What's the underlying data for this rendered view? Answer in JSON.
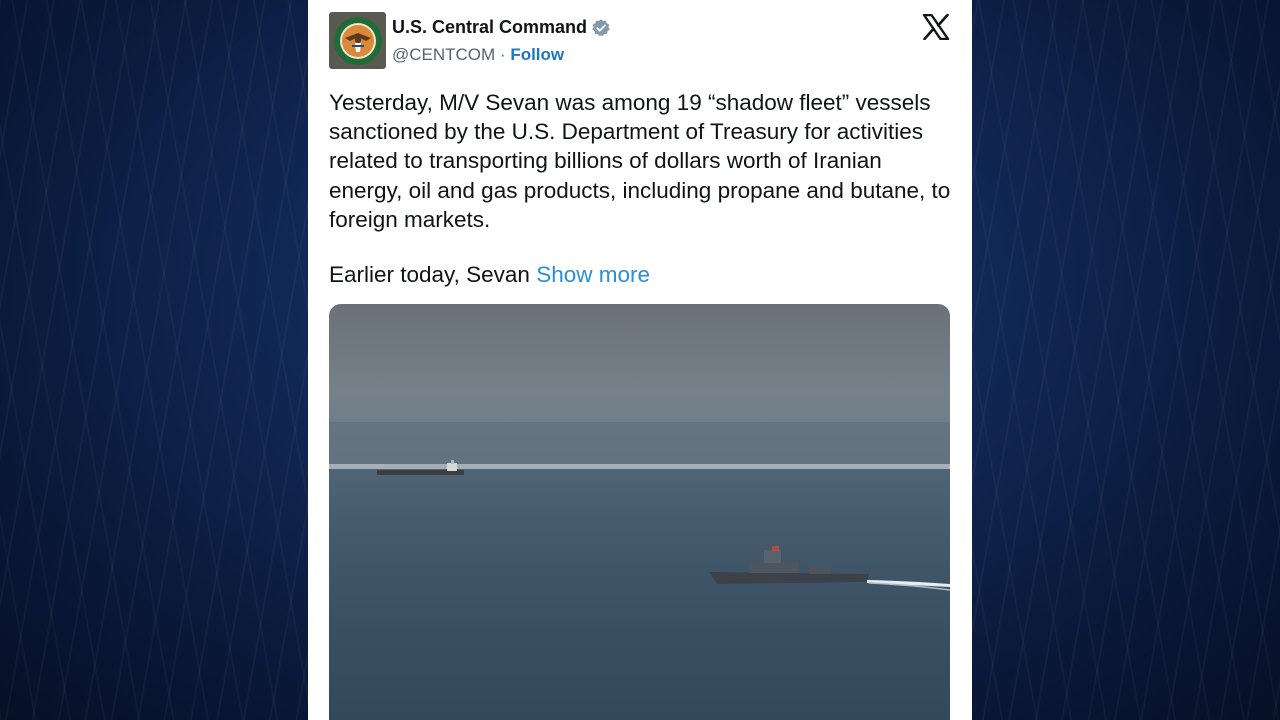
{
  "tweet": {
    "author_name": "U.S. Central Command",
    "handle": "@CENTCOM",
    "separator": " · ",
    "follow_label": "Follow",
    "text_paragraph_1": "Yesterday, M/V Sevan was among 19 “shadow fleet” vessels sanctioned by the U.S. Department of Treasury for activities related to transporting billions of dollars worth of Iranian energy, oil and gas products, including propane and butane, to foreign markets.",
    "text_paragraph_2": "Earlier today, Sevan ",
    "show_more_label": "Show more"
  },
  "icons": {
    "avatar": "centcom-seal-icon",
    "verified": "verified-badge-icon",
    "platform": "x-logo-icon"
  },
  "colors": {
    "link": "#2a8fd4",
    "follow": "#1d78c1",
    "background": "#122a58"
  }
}
